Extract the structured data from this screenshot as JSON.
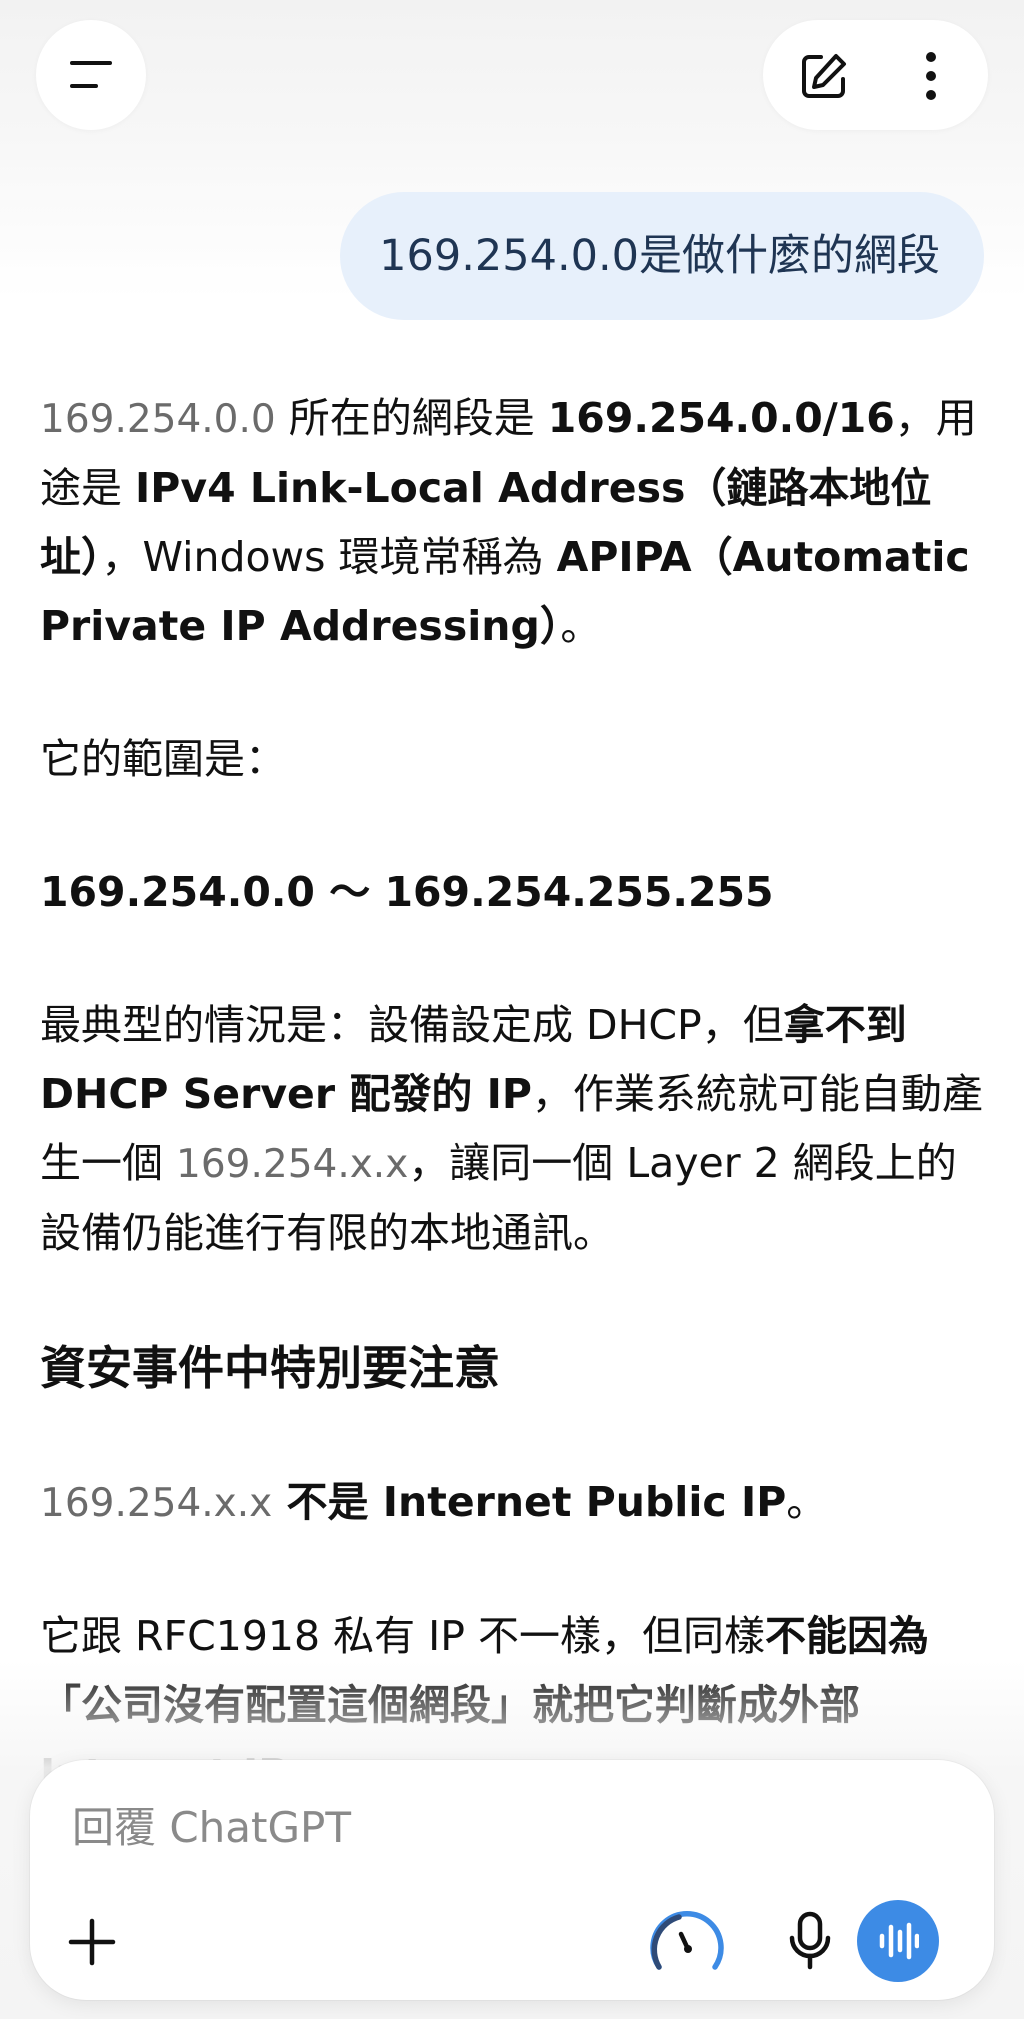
{
  "header": {
    "menu_icon": "hamburger-menu-icon",
    "new_chat_icon": "edit-pencil-icon",
    "more_icon": "more-vertical-icon"
  },
  "user_message": "169.254.0.0是做什麼的網段",
  "answer": {
    "p1": {
      "seg1": "169.254.0.0",
      "seg2": " 所在的網段是 ",
      "seg3": "169.254.0.0/16",
      "seg4": "，用途是 ",
      "seg5": "IPv4 Link-Local Address（鏈路本地位址）",
      "seg6": "，Windows 環境常稱為 ",
      "seg7": "APIPA（Automatic Private IP Addressing）",
      "seg8": "。"
    },
    "p2": "它的範圍是：",
    "p3": "169.254.0.0 ～ 169.254.255.255",
    "p4": {
      "seg1": "最典型的情況是：設備設定成 DHCP，但",
      "seg2": "拿不到 DHCP Server 配發的 IP",
      "seg3": "，作業系統就可能自動產生一個 ",
      "seg4": "169.254.x.x",
      "seg5": "，讓同一個 Layer 2 網段上的設備仍能進行有限的本地通訊。"
    },
    "heading": "資安事件中特別要注意",
    "p5": {
      "seg1": "169.254.x.x",
      "seg2": " 不是 Internet Public IP",
      "seg3": "。"
    },
    "p6": {
      "seg1": "它跟 RFC1918 私有 IP 不一樣，但同樣",
      "seg2": "不能因為「公司沒有配置這個網段」就把它判斷成外部 Internet IP",
      "seg3": "。"
    }
  },
  "composer": {
    "placeholder": "回覆 ChatGPT",
    "add_icon": "plus-icon",
    "reasoning_icon": "speedometer-icon",
    "mic_icon": "microphone-icon",
    "voice_icon": "voice-waveform-icon"
  },
  "colors": {
    "user_bubble": "#e7f0fb",
    "voice_button": "#3d8be5",
    "reasoning_icon": "#3d8be5"
  }
}
